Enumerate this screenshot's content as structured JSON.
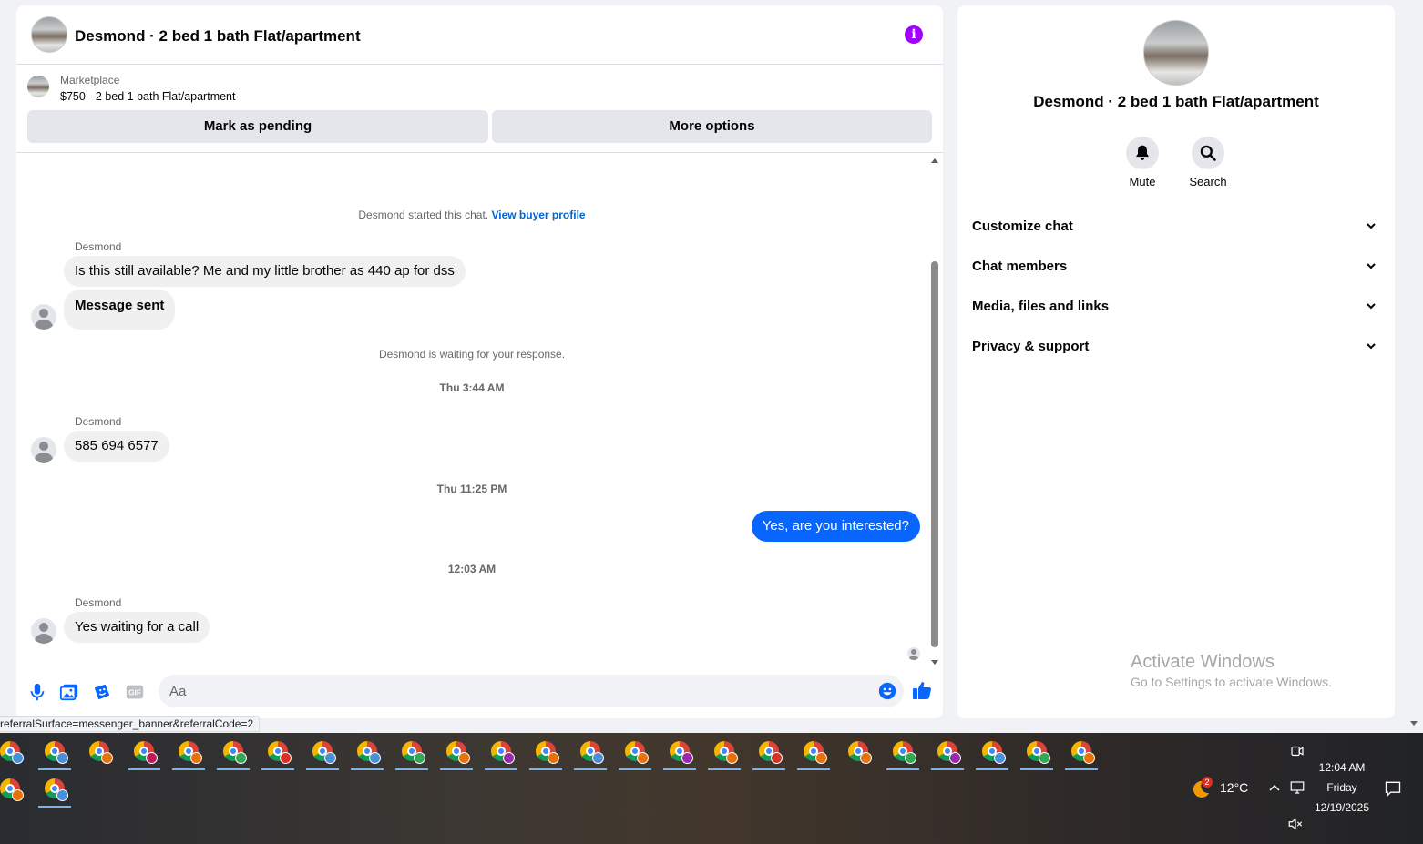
{
  "chat": {
    "title": "Desmond · 2 bed 1 bath Flat/apartment",
    "listing": {
      "source": "Marketplace",
      "title": "$750 - 2 bed 1 bath Flat/apartment",
      "mark_pending_label": "Mark as pending",
      "more_options_label": "More options"
    },
    "system_start_text": "Desmond started this chat.",
    "view_buyer_profile": "View buyer profile",
    "waiting_text": "Desmond is waiting for your response.",
    "messages": [
      {
        "sender": "Desmond",
        "text": "Is this still available? Me and my little brother as 440 ap for dss"
      },
      {
        "text": "Message sent"
      },
      {
        "timestamp": "Thu 3:44 AM"
      },
      {
        "sender": "Desmond",
        "text": "585 694 6577"
      },
      {
        "timestamp": "Thu 11:25 PM"
      },
      {
        "outgoing": true,
        "text": "Yes, are you interested?"
      },
      {
        "timestamp": "12:03 AM"
      },
      {
        "sender": "Desmond",
        "text": "Yes waiting for a call"
      }
    ],
    "composer": {
      "placeholder": "Aa"
    },
    "status_url": "referralSurface=messenger_banner&referralCode=2"
  },
  "info_panel": {
    "title": "Desmond · 2 bed 1 bath Flat/apartment",
    "actions": [
      {
        "label": "Mute",
        "icon": "bell-icon"
      },
      {
        "label": "Search",
        "icon": "search-icon"
      }
    ],
    "sections": [
      {
        "label": "Customize chat"
      },
      {
        "label": "Chat members"
      },
      {
        "label": "Media, files and links"
      },
      {
        "label": "Privacy & support"
      }
    ],
    "watermark_title": "Activate Windows",
    "watermark_sub": "Go to Settings to activate Windows."
  },
  "taskbar": {
    "weather_temp": "12°C",
    "weather_badge": "2",
    "time": "12:04 AM",
    "day": "Friday",
    "date": "12/19/2025",
    "app_badge_colors": [
      "#4a90d9",
      "#4a90d9",
      "#e8710a",
      "#c2185b",
      "#e8710a",
      "#34a853",
      "#d93025",
      "#4a90d9",
      "#4a90d9",
      "#34a853",
      "#e8710a",
      "#9c27b0",
      "#e8710a",
      "#4a90d9",
      "#e8710a",
      "#9c27b0",
      "#e8710a",
      "#d93025",
      "#e8710a",
      "#e8710a",
      "#34a853",
      "#9c27b0",
      "#4a90d9",
      "#34a853",
      "#e8710a",
      "#e8710a",
      "#4a90d9"
    ]
  },
  "colors": {
    "accent": "#0866ff",
    "info_icon": "#a100ff",
    "link": "#0064d1"
  }
}
